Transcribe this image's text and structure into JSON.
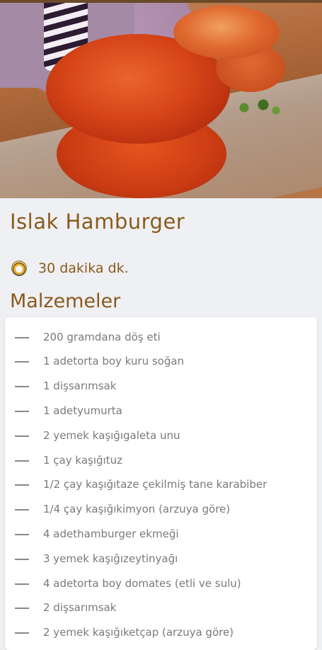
{
  "recipe": {
    "title": "Islak Hamburger",
    "time_text": "30 dakika dk.",
    "ingredients_title": "Malzemeler",
    "ingredients": [
      "200 gramdana döş eti",
      "1 adetorta boy kuru soğan",
      "1 dişsarımsak",
      "1 adetyumurta",
      "2 yemek kaşığıgaleta unu",
      "1 çay kaşığıtuz",
      "1/2 çay kaşığıtaze çekilmiş tane karabiber",
      "1/4 çay kaşığıkimyon (arzuya göre)",
      "4 adethamburger ekmeği",
      "3 yemek kaşığızeytinyağı",
      "4 adetorta boy domates (etli ve sulu)",
      "2 dişsarımsak",
      "2 yemek kaşığıketçap (arzuya göre)"
    ]
  },
  "icons": {
    "time": "clock-icon",
    "bullet": "dash-icon"
  },
  "colors": {
    "accent": "#8a5a1c",
    "background": "#eef0f3",
    "card": "#ffffff",
    "ingredient_text": "#7a7a7a"
  }
}
